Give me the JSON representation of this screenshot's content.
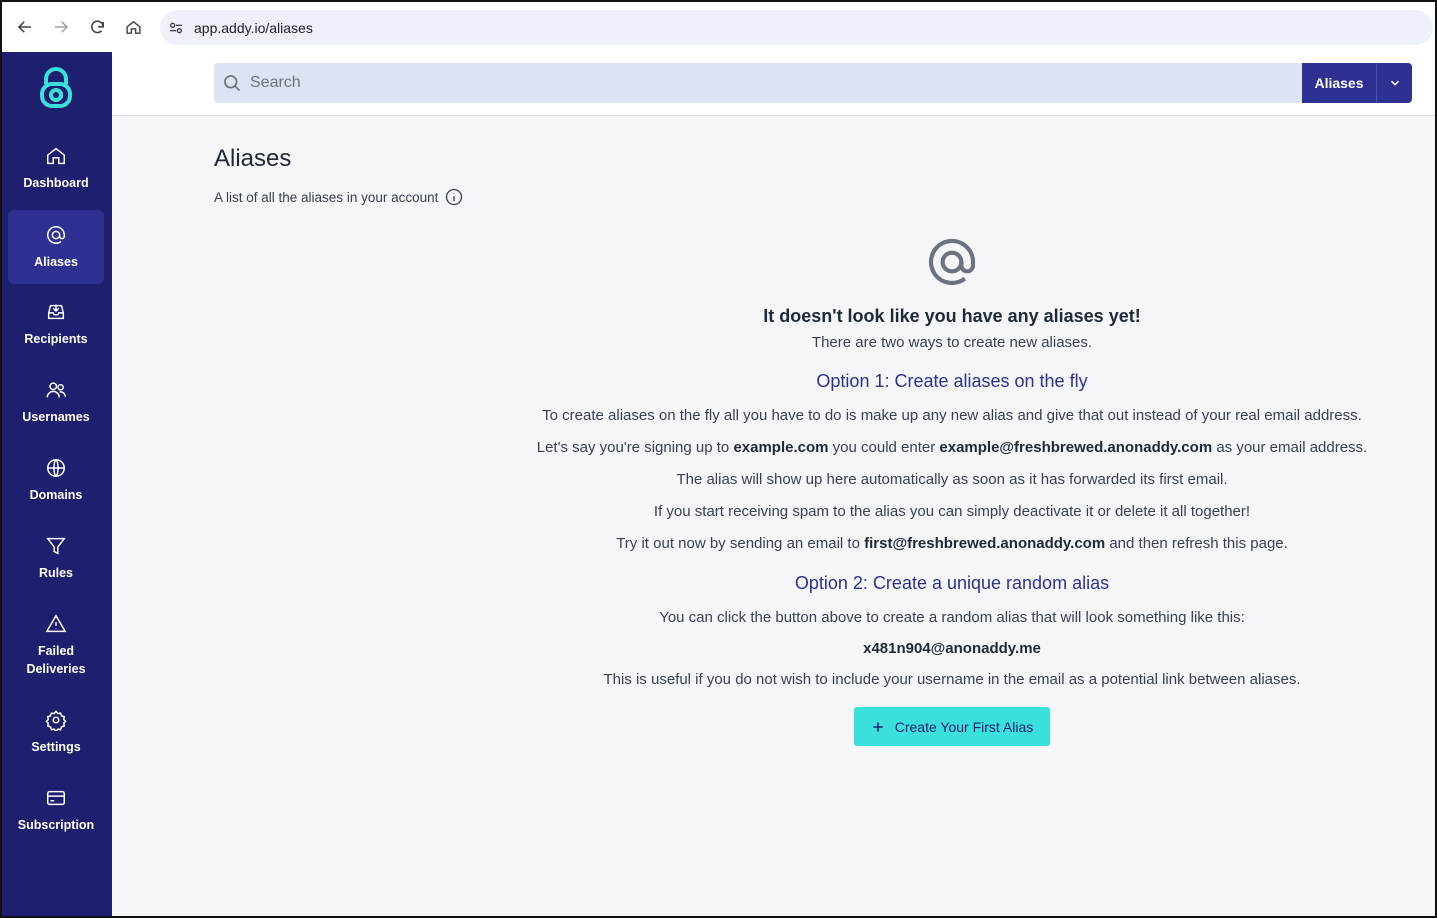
{
  "browser": {
    "url": "app.addy.io/aliases"
  },
  "sidebar": {
    "items": [
      {
        "label": "Dashboard",
        "icon": "home-icon"
      },
      {
        "label": "Aliases",
        "icon": "at-icon",
        "active": true
      },
      {
        "label": "Recipients",
        "icon": "inbox-icon"
      },
      {
        "label": "Usernames",
        "icon": "users-icon"
      },
      {
        "label": "Domains",
        "icon": "globe-icon"
      },
      {
        "label": "Rules",
        "icon": "filter-icon"
      },
      {
        "label": "Failed Deliveries",
        "icon": "warning-icon"
      },
      {
        "label": "Settings",
        "icon": "gear-icon"
      },
      {
        "label": "Subscription",
        "icon": "credit-card-icon"
      }
    ]
  },
  "search": {
    "placeholder": "Search",
    "scope": "Aliases"
  },
  "page": {
    "title": "Aliases",
    "subtitle": "A list of all the aliases in your account"
  },
  "empty": {
    "title": "It doesn't look like you have any aliases yet!",
    "subtitle": "There are two ways to create new aliases.",
    "option1": {
      "heading": "Option 1: Create aliases on the fly",
      "line1": "To create aliases on the fly all you have to do is make up any new alias and give that out instead of your real email address.",
      "line2_prefix": "Let's say you're signing up to ",
      "line2_domain": "example.com",
      "line2_mid": " you could enter ",
      "line2_alias": "example@freshbrewed.anonaddy.com",
      "line2_suffix": " as your email address.",
      "line3": "The alias will show up here automatically as soon as it has forwarded its first email.",
      "line4": "If you start receiving spam to the alias you can simply deactivate it or delete it all together!",
      "line5_prefix": "Try it out now by sending an email to ",
      "line5_alias": "first@freshbrewed.anonaddy.com",
      "line5_suffix": " and then refresh this page."
    },
    "option2": {
      "heading": "Option 2: Create a unique random alias",
      "line1": "You can click the button above to create a random alias that will look something like this:",
      "example": "x481n904@anonaddy.me",
      "line2": "This is useful if you do not wish to include your username in the email as a potential link between aliases."
    },
    "button": "Create Your First Alias"
  },
  "colors": {
    "sidebar": "#1e1f6e",
    "sidebar_active": "#2e3191",
    "accent": "#3be0dc",
    "heading": "#2e3191"
  }
}
